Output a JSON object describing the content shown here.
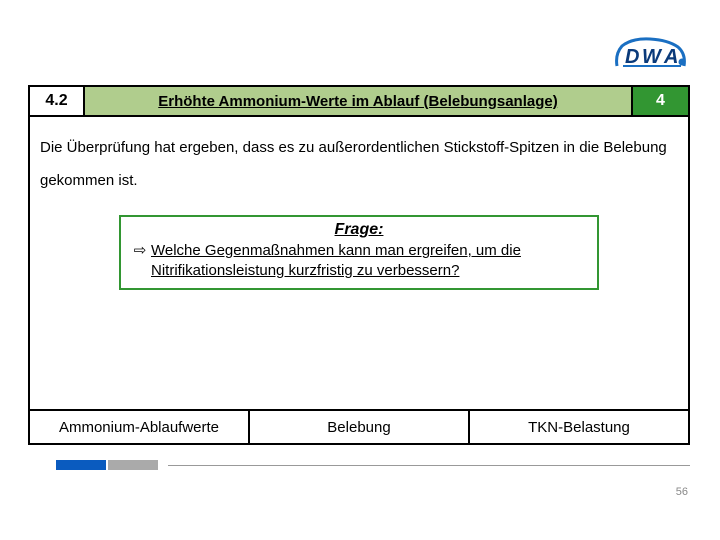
{
  "logo": {
    "text": "DWA",
    "color_dark": "#0a3a7a",
    "color_light": "#1a6fc2"
  },
  "header": {
    "section_number": "4.2",
    "title": "Erhöhte Ammonium-Werte im Ablauf (Belebungsanlage)",
    "step": "4"
  },
  "body": {
    "intro": "Die Überprüfung hat ergeben, dass es zu außerordentlichen Stickstoff-Spitzen in die Belebung gekommen ist."
  },
  "question": {
    "label": "Frage:",
    "arrow": "⇨",
    "text": "Welche Gegenmaßnahmen kann man ergreifen, um die Nitrifikationsleistung kurzfristig zu verbessern?"
  },
  "bottom": {
    "cells": [
      "Ammonium-Ablaufwerte",
      "Belebung",
      "TKN-Belastung"
    ]
  },
  "page_number": "56"
}
